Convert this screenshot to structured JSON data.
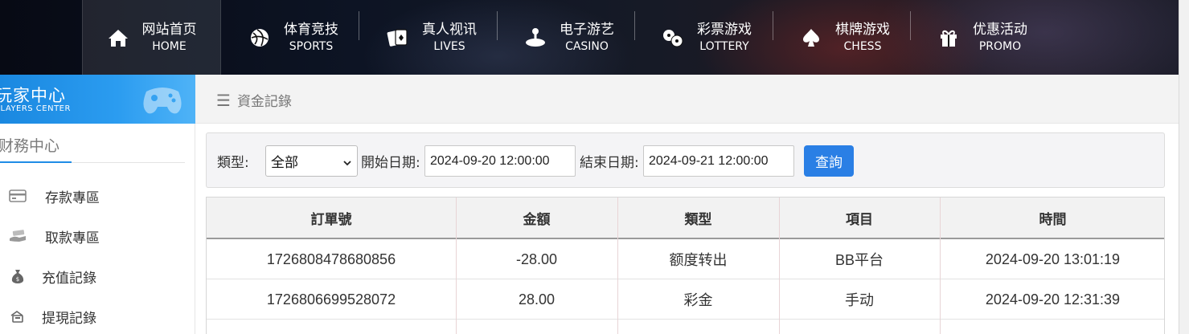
{
  "nav": {
    "items": [
      {
        "cn": "网站首页",
        "en": "HOME",
        "icon": "home-icon",
        "active": true
      },
      {
        "cn": "体育竞技",
        "en": "SPORTS",
        "icon": "ball-icon"
      },
      {
        "cn": "真人视讯",
        "en": "LIVES",
        "icon": "cards-icon"
      },
      {
        "cn": "电子游艺",
        "en": "CASINO",
        "icon": "joystick-icon"
      },
      {
        "cn": "彩票游戏",
        "en": "LOTTERY",
        "icon": "lottery-balls-icon"
      },
      {
        "cn": "棋牌游戏",
        "en": "CHESS",
        "icon": "spade-icon"
      },
      {
        "cn": "优惠活动",
        "en": "PROMO",
        "icon": "gift-icon"
      }
    ]
  },
  "sidebar": {
    "title_cn": "玩家中心",
    "title_en": "PLAYERS CENTER",
    "section": "财務中心",
    "items": [
      {
        "label": "存款專區",
        "icon": "card-icon"
      },
      {
        "label": "取款專區",
        "icon": "cash-hand-icon"
      },
      {
        "label": "充值記錄",
        "icon": "money-bag-icon"
      },
      {
        "label": "提現記錄",
        "icon": "withdraw-icon"
      }
    ]
  },
  "breadcrumb": {
    "label": "資金記錄",
    "icon": "menu-icon"
  },
  "filter": {
    "type_label": "類型:",
    "type_value": "全部",
    "start_label": "開始日期:",
    "start_value": "2024-09-20 12:00:00",
    "end_label": "結束日期:",
    "end_value": "2024-09-21 12:00:00",
    "query_label": "查詢"
  },
  "table": {
    "headers": [
      "訂單號",
      "金額",
      "類型",
      "項目",
      "時間"
    ],
    "rows": [
      [
        "1726808478680856",
        "-28.00",
        "额度转出",
        "BB平台",
        "2024-09-20 13:01:19"
      ],
      [
        "1726806699528072",
        "28.00",
        "彩金",
        "手动",
        "2024-09-20 12:31:39"
      ]
    ]
  },
  "colors": {
    "accent": "#2a7fe5",
    "sidebar_header": "#1a88e0"
  }
}
